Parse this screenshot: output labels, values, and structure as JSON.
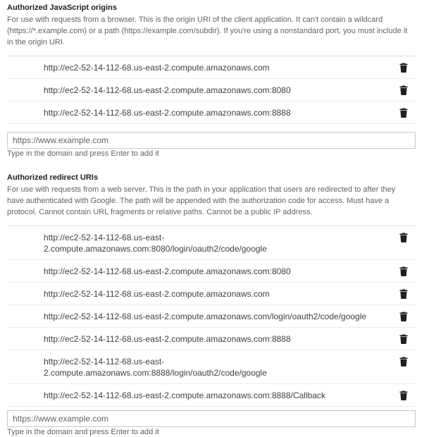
{
  "js_origins": {
    "title": "Authorized JavaScript origins",
    "description": "For use with requests from a browser. This is the origin URI of the client application. It can't contain a wildcard (https://*.example.com) or a path (https://example.com/subdir). If you're using a nonstandard port, you must include it in the origin URI.",
    "items": [
      "http://ec2-52-14-112-68.us-east-2.compute.amazonaws.com",
      "http://ec2-52-14-112-68.us-east-2.compute.amazonaws.com:8080",
      "http://ec2-52-14-112-68.us-east-2.compute.amazonaws.com:8888"
    ],
    "input_placeholder": "https://www.example.com",
    "hint": "Type in the domain and press Enter to add it"
  },
  "redirect_uris": {
    "title": "Authorized redirect URIs",
    "description": "For use with requests from a web server. This is the path in your application that users are redirected to after they have authenticated with Google. The path will be appended with the authorization code for access. Must have a protocol. Cannot contain URL fragments or relative paths. Cannot be a public IP address.",
    "items": [
      [
        "http://ec2-52-14-112-68.us-east-",
        "2.compute.amazonaws.com:8080/login/oauth2/code/google"
      ],
      [
        "http://ec2-52-14-112-68.us-east-2.compute.amazonaws.com:8080"
      ],
      [
        "http://ec2-52-14-112-68.us-east-2.compute.amazonaws.com"
      ],
      [
        "http://ec2-52-14-112-68.us-east-2.compute.amazonaws.com/login/oauth2/code/google"
      ],
      [
        "http://ec2-52-14-112-68.us-east-2.compute.amazonaws.com:8888"
      ],
      [
        "http://ec2-52-14-112-68.us-east-",
        "2.compute.amazonaws.com:8888/login/oauth2/code/google"
      ],
      [
        "http://ec2-52-14-112-68.us-east-2.compute.amazonaws.com:8888/Callback"
      ]
    ],
    "input_placeholder": "https://www.example.com",
    "hint": "Type in the domain and press Enter to add it"
  },
  "icons": {
    "delete": "trash-icon"
  }
}
